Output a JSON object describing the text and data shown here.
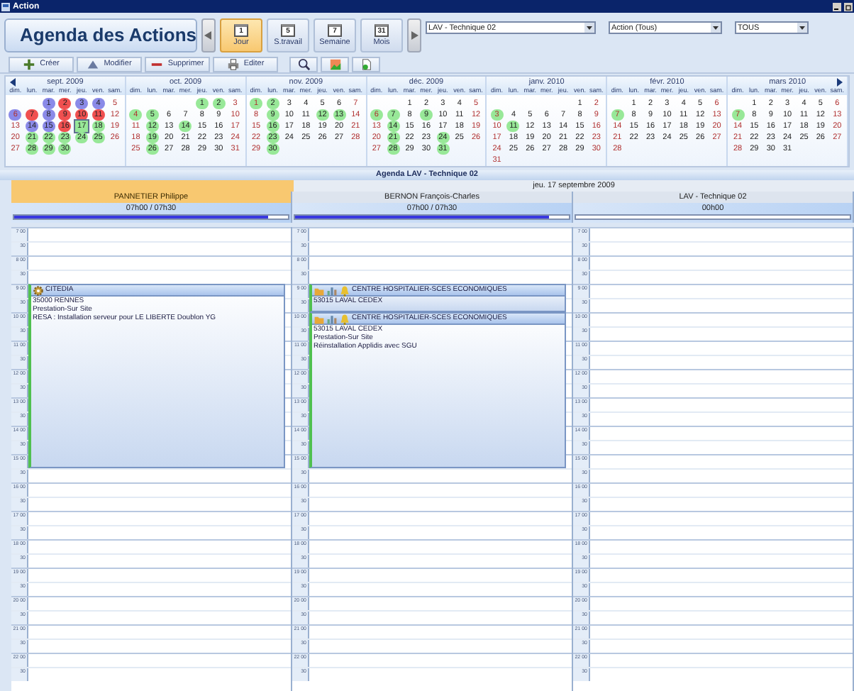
{
  "window": {
    "title": "Action"
  },
  "header": {
    "title": "Agenda des Actions",
    "views": [
      {
        "label": "Jour",
        "icon_text": "1",
        "selected": true
      },
      {
        "label": "S.travail",
        "icon_text": "5",
        "selected": false
      },
      {
        "label": "Semaine",
        "icon_text": "7",
        "selected": false
      },
      {
        "label": "Mois",
        "icon_text": "31",
        "selected": false
      }
    ],
    "dropdowns": [
      {
        "value": "LAV - Technique 02"
      },
      {
        "value": "Action (Tous)"
      },
      {
        "value": "TOUS"
      }
    ]
  },
  "toolbar": [
    {
      "kind": "text",
      "label": "Créer"
    },
    {
      "kind": "text",
      "label": "Modifier"
    },
    {
      "kind": "text",
      "label": "Supprimer"
    },
    {
      "kind": "text",
      "label": "Editer"
    },
    {
      "kind": "icon"
    },
    {
      "kind": "icon"
    },
    {
      "kind": "icon"
    }
  ],
  "months": [
    {
      "title": "sept. 2009",
      "weekdays": [
        "dim.",
        "lun.",
        "mar.",
        "mer.",
        "jeu.",
        "ven.",
        "sam."
      ],
      "weeks": [
        {
          "kind": "first",
          "days": [
            {
              "d": "1",
              "color": "#8a8ae8"
            },
            {
              "d": "2",
              "color": "#f05050"
            },
            {
              "d": "3",
              "color": "#8a8ae8"
            },
            {
              "d": "4",
              "color": "#8a8ae8"
            },
            {
              "d": "5"
            }
          ]
        },
        {
          "kind": "week",
          "days": [
            {
              "d": "6",
              "color": "#8a8ae8"
            },
            {
              "d": "7",
              "color": "#f05050"
            },
            {
              "d": "8",
              "color": "#8a8ae8"
            },
            {
              "d": "9",
              "color": "#f05050"
            },
            {
              "d": "10",
              "color": "#f05050"
            },
            {
              "d": "11",
              "color": "#f05050"
            },
            {
              "d": "12"
            }
          ]
        },
        {
          "kind": "week",
          "days": [
            {
              "d": "13"
            },
            {
              "d": "14",
              "color": "#8a8ae8"
            },
            {
              "d": "15",
              "color": "#8a8ae8"
            },
            {
              "d": "16",
              "color": "#f05050"
            },
            {
              "d": "17",
              "color": "#98e898",
              "selected": true
            },
            {
              "d": "18",
              "color": "#98e898"
            },
            {
              "d": "19"
            }
          ]
        },
        {
          "kind": "week",
          "days": [
            {
              "d": "20"
            },
            {
              "d": "21",
              "color": "#98e898"
            },
            {
              "d": "22",
              "color": "#98e898"
            },
            {
              "d": "23",
              "color": "#98e898"
            },
            {
              "d": "24",
              "color": "#98e898"
            },
            {
              "d": "25",
              "color": "#98e898"
            },
            {
              "d": "26"
            }
          ]
        },
        {
          "kind": "week",
          "days": [
            {
              "d": "27"
            },
            {
              "d": "28",
              "color": "#98e898"
            },
            {
              "d": "29",
              "color": "#98e898"
            },
            {
              "d": "30",
              "color": "#98e898"
            }
          ]
        }
      ]
    },
    {
      "title": "oct. 2009",
      "weekdays": [
        "dim.",
        "lun.",
        "mar.",
        "mer.",
        "jeu.",
        "ven.",
        "sam."
      ],
      "weeks": [
        {
          "kind": "first",
          "days": [
            {
              "d": "1",
              "color": "#98e898"
            },
            {
              "d": "2",
              "color": "#98e898"
            },
            {
              "d": "3"
            }
          ]
        },
        {
          "kind": "week",
          "days": [
            {
              "d": "4",
              "color": "#98e898"
            },
            {
              "d": "5",
              "color": "#98e898"
            },
            {
              "d": "6"
            },
            {
              "d": "7"
            },
            {
              "d": "8"
            },
            {
              "d": "9"
            },
            {
              "d": "10"
            }
          ]
        },
        {
          "kind": "week",
          "days": [
            {
              "d": "11"
            },
            {
              "d": "12",
              "color": "#98e898"
            },
            {
              "d": "13"
            },
            {
              "d": "14",
              "color": "#98e898"
            },
            {
              "d": "15"
            },
            {
              "d": "16"
            },
            {
              "d": "17"
            }
          ]
        },
        {
          "kind": "week",
          "days": [
            {
              "d": "18"
            },
            {
              "d": "19",
              "color": "#98e898"
            },
            {
              "d": "20"
            },
            {
              "d": "21"
            },
            {
              "d": "22"
            },
            {
              "d": "23"
            },
            {
              "d": "24"
            }
          ]
        },
        {
          "kind": "week",
          "days": [
            {
              "d": "25"
            },
            {
              "d": "26",
              "color": "#98e898"
            },
            {
              "d": "27"
            },
            {
              "d": "28"
            },
            {
              "d": "29"
            },
            {
              "d": "30"
            },
            {
              "d": "31"
            }
          ]
        }
      ]
    },
    {
      "title": "nov. 2009",
      "weekdays": [
        "dim.",
        "lun.",
        "mar.",
        "mer.",
        "jeu.",
        "ven.",
        "sam."
      ],
      "weeks": [
        {
          "kind": "first",
          "days": [
            {
              "d": "1",
              "color": "#98e898"
            },
            {
              "d": "2",
              "color": "#98e898"
            },
            {
              "d": "3"
            },
            {
              "d": "4"
            },
            {
              "d": "5"
            },
            {
              "d": "6"
            },
            {
              "d": "7"
            }
          ]
        },
        {
          "kind": "week",
          "days": [
            {
              "d": "8"
            },
            {
              "d": "9",
              "color": "#98e898"
            },
            {
              "d": "10"
            },
            {
              "d": "11"
            },
            {
              "d": "12",
              "color": "#98e898"
            },
            {
              "d": "13",
              "color": "#98e898"
            },
            {
              "d": "14"
            }
          ]
        },
        {
          "kind": "week",
          "days": [
            {
              "d": "15"
            },
            {
              "d": "16",
              "color": "#98e898"
            },
            {
              "d": "17"
            },
            {
              "d": "18"
            },
            {
              "d": "19"
            },
            {
              "d": "20"
            },
            {
              "d": "21"
            }
          ]
        },
        {
          "kind": "week",
          "days": [
            {
              "d": "22"
            },
            {
              "d": "23",
              "color": "#98e898"
            },
            {
              "d": "24"
            },
            {
              "d": "25"
            },
            {
              "d": "26"
            },
            {
              "d": "27"
            },
            {
              "d": "28"
            }
          ]
        },
        {
          "kind": "week",
          "days": [
            {
              "d": "29"
            },
            {
              "d": "30",
              "color": "#98e898"
            }
          ]
        }
      ]
    },
    {
      "title": "déc. 2009",
      "weekdays": [
        "dim.",
        "lun.",
        "mar.",
        "mer.",
        "jeu.",
        "ven.",
        "sam."
      ],
      "weeks": [
        {
          "kind": "first",
          "days": [
            {
              "d": "1"
            },
            {
              "d": "2"
            },
            {
              "d": "3"
            },
            {
              "d": "4"
            },
            {
              "d": "5"
            }
          ]
        },
        {
          "kind": "week",
          "days": [
            {
              "d": "6",
              "color": "#98e898"
            },
            {
              "d": "7",
              "color": "#98e898"
            },
            {
              "d": "8"
            },
            {
              "d": "9",
              "color": "#98e898"
            },
            {
              "d": "10"
            },
            {
              "d": "11"
            },
            {
              "d": "12"
            }
          ]
        },
        {
          "kind": "week",
          "days": [
            {
              "d": "13"
            },
            {
              "d": "14",
              "color": "#98e898"
            },
            {
              "d": "15"
            },
            {
              "d": "16"
            },
            {
              "d": "17"
            },
            {
              "d": "18"
            },
            {
              "d": "19"
            }
          ]
        },
        {
          "kind": "week",
          "days": [
            {
              "d": "20"
            },
            {
              "d": "21",
              "color": "#98e898"
            },
            {
              "d": "22"
            },
            {
              "d": "23"
            },
            {
              "d": "24",
              "color": "#98e898"
            },
            {
              "d": "25"
            },
            {
              "d": "26"
            }
          ]
        },
        {
          "kind": "week",
          "days": [
            {
              "d": "27"
            },
            {
              "d": "28",
              "color": "#98e898"
            },
            {
              "d": "29"
            },
            {
              "d": "30"
            },
            {
              "d": "31",
              "color": "#98e898"
            }
          ]
        }
      ]
    },
    {
      "title": "janv. 2010",
      "weekdays": [
        "dim.",
        "lun.",
        "mar.",
        "mer.",
        "jeu.",
        "ven.",
        "sam."
      ],
      "weeks": [
        {
          "kind": "first",
          "days": [
            {
              "d": "1"
            },
            {
              "d": "2"
            }
          ]
        },
        {
          "kind": "week",
          "days": [
            {
              "d": "3",
              "color": "#98e898"
            },
            {
              "d": "4"
            },
            {
              "d": "5"
            },
            {
              "d": "6"
            },
            {
              "d": "7"
            },
            {
              "d": "8"
            },
            {
              "d": "9"
            }
          ]
        },
        {
          "kind": "week",
          "days": [
            {
              "d": "10"
            },
            {
              "d": "11",
              "color": "#98e898"
            },
            {
              "d": "12"
            },
            {
              "d": "13"
            },
            {
              "d": "14"
            },
            {
              "d": "15"
            },
            {
              "d": "16"
            }
          ]
        },
        {
          "kind": "week",
          "days": [
            {
              "d": "17"
            },
            {
              "d": "18"
            },
            {
              "d": "19"
            },
            {
              "d": "20"
            },
            {
              "d": "21"
            },
            {
              "d": "22"
            },
            {
              "d": "23"
            }
          ]
        },
        {
          "kind": "week",
          "days": [
            {
              "d": "24"
            },
            {
              "d": "25"
            },
            {
              "d": "26"
            },
            {
              "d": "27"
            },
            {
              "d": "28"
            },
            {
              "d": "29"
            },
            {
              "d": "30"
            }
          ]
        },
        {
          "kind": "week",
          "days": [
            {
              "d": "31"
            }
          ]
        }
      ]
    },
    {
      "title": "févr. 2010",
      "weekdays": [
        "dim.",
        "lun.",
        "mar.",
        "mer.",
        "jeu.",
        "ven.",
        "sam."
      ],
      "weeks": [
        {
          "kind": "first",
          "days": [
            {
              "d": "1"
            },
            {
              "d": "2"
            },
            {
              "d": "3"
            },
            {
              "d": "4"
            },
            {
              "d": "5"
            },
            {
              "d": "6"
            }
          ]
        },
        {
          "kind": "week",
          "days": [
            {
              "d": "7",
              "color": "#98e898"
            },
            {
              "d": "8"
            },
            {
              "d": "9"
            },
            {
              "d": "10"
            },
            {
              "d": "11"
            },
            {
              "d": "12"
            },
            {
              "d": "13"
            }
          ]
        },
        {
          "kind": "week",
          "days": [
            {
              "d": "14"
            },
            {
              "d": "15"
            },
            {
              "d": "16"
            },
            {
              "d": "17"
            },
            {
              "d": "18"
            },
            {
              "d": "19"
            },
            {
              "d": "20"
            }
          ]
        },
        {
          "kind": "week",
          "days": [
            {
              "d": "21"
            },
            {
              "d": "22"
            },
            {
              "d": "23"
            },
            {
              "d": "24"
            },
            {
              "d": "25"
            },
            {
              "d": "26"
            },
            {
              "d": "27"
            }
          ]
        },
        {
          "kind": "week",
          "days": [
            {
              "d": "28"
            }
          ]
        }
      ]
    },
    {
      "title": "mars 2010",
      "weekdays": [
        "dim.",
        "lun.",
        "mar.",
        "mer.",
        "jeu.",
        "ven.",
        "sam."
      ],
      "weeks": [
        {
          "kind": "first",
          "days": [
            {
              "d": "1"
            },
            {
              "d": "2"
            },
            {
              "d": "3"
            },
            {
              "d": "4"
            },
            {
              "d": "5"
            },
            {
              "d": "6"
            }
          ]
        },
        {
          "kind": "week",
          "days": [
            {
              "d": "7",
              "color": "#98e898"
            },
            {
              "d": "8"
            },
            {
              "d": "9"
            },
            {
              "d": "10"
            },
            {
              "d": "11"
            },
            {
              "d": "12"
            },
            {
              "d": "13"
            }
          ]
        },
        {
          "kind": "week",
          "days": [
            {
              "d": "14"
            },
            {
              "d": "15"
            },
            {
              "d": "16"
            },
            {
              "d": "17"
            },
            {
              "d": "18"
            },
            {
              "d": "19"
            },
            {
              "d": "20"
            }
          ]
        },
        {
          "kind": "week",
          "days": [
            {
              "d": "21"
            },
            {
              "d": "22"
            },
            {
              "d": "23"
            },
            {
              "d": "24"
            },
            {
              "d": "25"
            },
            {
              "d": "26"
            },
            {
              "d": "27"
            }
          ]
        },
        {
          "kind": "week",
          "days": [
            {
              "d": "28"
            },
            {
              "d": "29"
            },
            {
              "d": "30"
            },
            {
              "d": "31"
            }
          ]
        }
      ]
    }
  ],
  "agenda": {
    "title": "Agenda LAV - Technique 02",
    "date": "jeu. 17 septembre 2009",
    "columns": [
      {
        "name": "PANNETIER Philippe",
        "selected": true,
        "hours": "07h00 / 07h30",
        "level": 0.93,
        "time_slots": [
          "7 00",
          "30",
          "8 00",
          "30",
          "9 00",
          "30",
          "10 00",
          "30",
          "11 00",
          "30",
          "12 00",
          "30",
          "13 00",
          "30",
          "14 00",
          "30",
          "15 00",
          "30",
          "16 00",
          "30",
          "17 00",
          "30",
          "18 00",
          "30",
          "19 00",
          "30",
          "20 00",
          "30",
          "21 00",
          "30",
          "22 00",
          "30"
        ],
        "appointments": [
          {
            "title": "CITEDIA",
            "lines": [
              "35000 RENNES",
              "Prestation-Sur Site",
              "RESA : Installation serveur pour LE LIBERTE Doublon YG"
            ]
          }
        ]
      },
      {
        "name": "BERNON François-Charles",
        "selected": false,
        "hours": "07h00 / 07h30",
        "level": 0.93,
        "time_slots": [
          "7 00",
          "30",
          "8 00",
          "30",
          "9 00",
          "30",
          "10 00",
          "30",
          "11 00",
          "30",
          "12 00",
          "30",
          "13 00",
          "30",
          "14 00",
          "30",
          "15 00",
          "30",
          "16 00",
          "30",
          "17 00",
          "30",
          "18 00",
          "30",
          "19 00",
          "30",
          "20 00",
          "30",
          "21 00",
          "30",
          "22 00",
          "30"
        ],
        "appointments": [
          {
            "title": "CENTRE HOSPITALIER-SCES ECONOMIQUES",
            "lines": [
              "53015 LAVAL CEDEX"
            ]
          },
          {
            "title": "CENTRE HOSPITALIER-SCES ECONOMIQUES",
            "lines": [
              "53015 LAVAL CEDEX",
              "Prestation-Sur Site",
              "Réinstallation Applidis avec SGU"
            ]
          }
        ]
      },
      {
        "name": "LAV - Technique 02",
        "selected": false,
        "hours": "00h00",
        "level": 0,
        "time_slots": [
          "7 00",
          "30",
          "8 00",
          "30",
          "9 00",
          "30",
          "10 00",
          "30",
          "11 00",
          "30",
          "12 00",
          "30",
          "13 00",
          "30",
          "14 00",
          "30",
          "15 00",
          "30",
          "16 00",
          "30",
          "17 00",
          "30",
          "18 00",
          "30",
          "19 00",
          "30",
          "20 00",
          "30",
          "21 00",
          "30",
          "22 00",
          "30"
        ]
      }
    ]
  }
}
